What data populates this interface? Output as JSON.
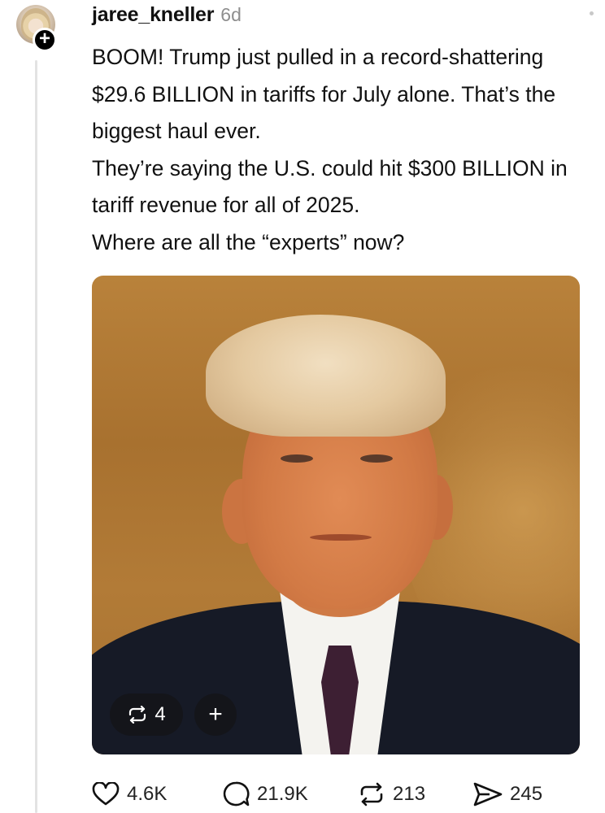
{
  "post": {
    "username": "jaree_kneller",
    "time": "6d",
    "text": "BOOM! Trump just pulled in a record-shattering $29.6 BILLION in tariffs for July alone. That’s the biggest haul ever.\nThey’re saying the U.S. could hit $300 BILLION in tariff revenue for all of 2025.\nWhere are all the “experts” now?",
    "follow_symbol": "+",
    "image_repost_count": "4",
    "image_add_symbol": "+"
  },
  "actions": {
    "likes": "4.6K",
    "replies": "21.9K",
    "reposts": "213",
    "shares": "245"
  },
  "icons": {
    "like": "heart-icon",
    "reply": "speech-bubble-icon",
    "repost": "repost-arrows-icon",
    "share": "paper-plane-icon"
  }
}
